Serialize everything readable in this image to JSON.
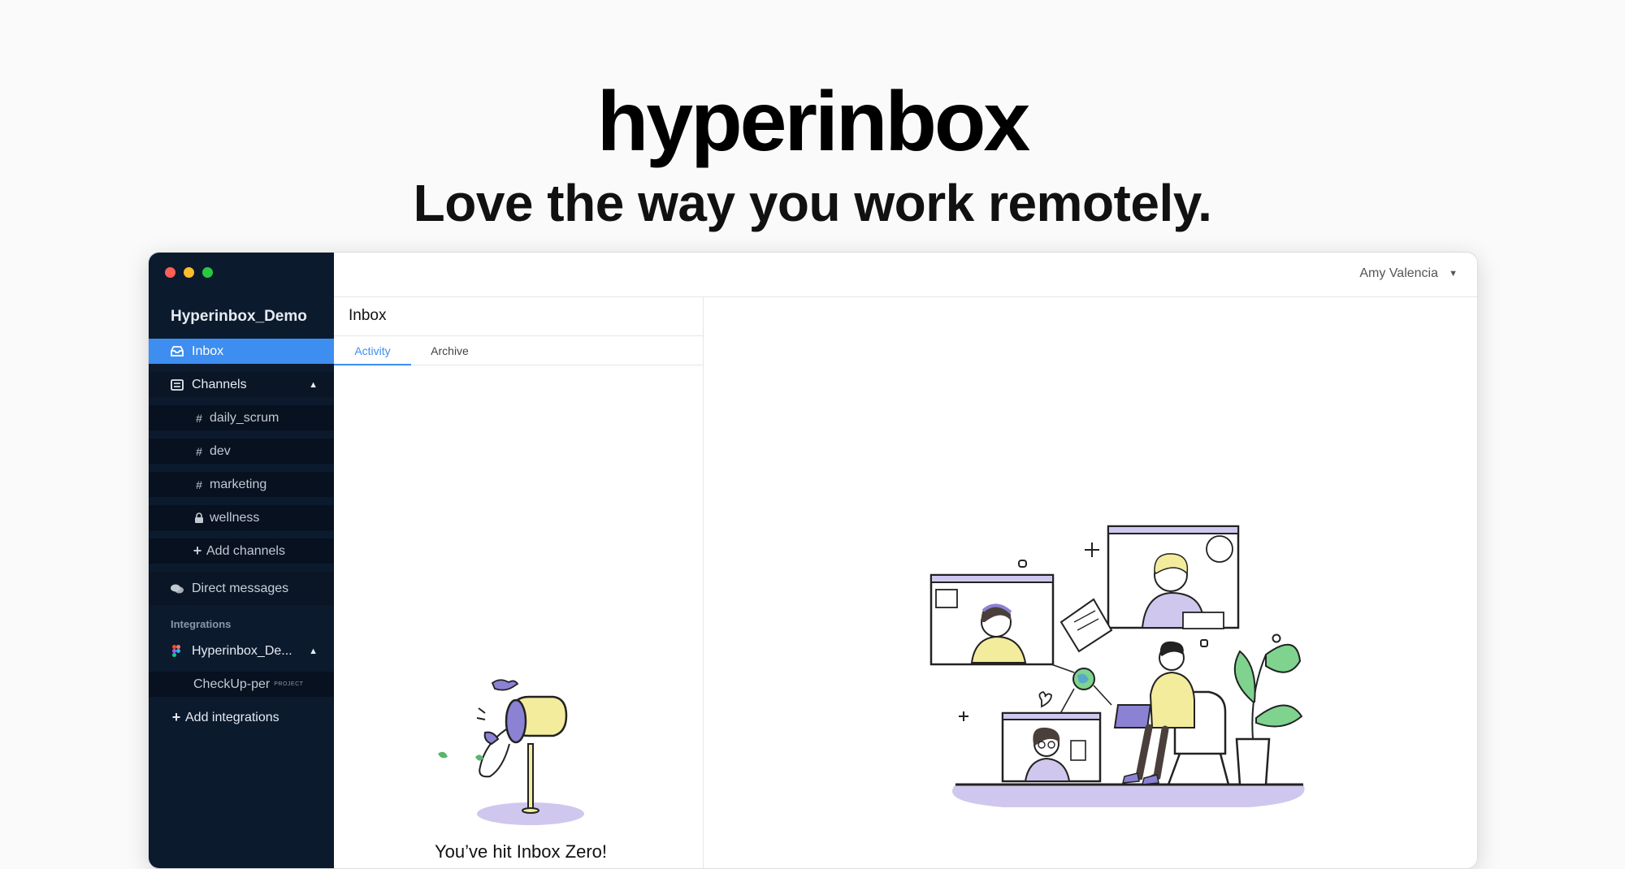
{
  "hero": {
    "title": "hyperinbox",
    "subtitle": "Love the way you work remotely."
  },
  "window": {
    "traffic_lights": [
      "#ff5f57",
      "#febc2e",
      "#28c840"
    ]
  },
  "sidebar": {
    "workspace": "Hyperinbox_Demo",
    "inbox": {
      "label": "Inbox",
      "icon": "inbox-icon"
    },
    "channels": {
      "label": "Channels",
      "icon": "list-icon",
      "items": [
        {
          "label": "daily_scrum",
          "icon": "hash-icon"
        },
        {
          "label": "dev",
          "icon": "hash-icon"
        },
        {
          "label": "marketing",
          "icon": "hash-icon"
        },
        {
          "label": "wellness",
          "icon": "lock-icon"
        }
      ],
      "add_label": "Add channels"
    },
    "direct_messages": {
      "label": "Direct messages",
      "icon": "chat-bubbles-icon"
    },
    "integrations_label": "Integrations",
    "integration": {
      "label": "Hyperinbox_De...",
      "icon": "figma-icon"
    },
    "integration_project": {
      "label": "CheckUp-per",
      "badge": "PROJECT"
    },
    "add_integrations": "Add integrations"
  },
  "topbar": {
    "user_name": "Amy Valencia"
  },
  "list": {
    "title": "Inbox",
    "tabs": [
      "Activity",
      "Archive"
    ],
    "active_tab": "Activity",
    "empty_state": "You’ve hit Inbox Zero!"
  },
  "colors": {
    "accent": "#3d8ef0",
    "sidebar_bg": "#0c1a2e",
    "lavender": "#cfc7ee",
    "purple": "#8b82d4",
    "yellow": "#f3ec9c",
    "green": "#7fd38f"
  }
}
